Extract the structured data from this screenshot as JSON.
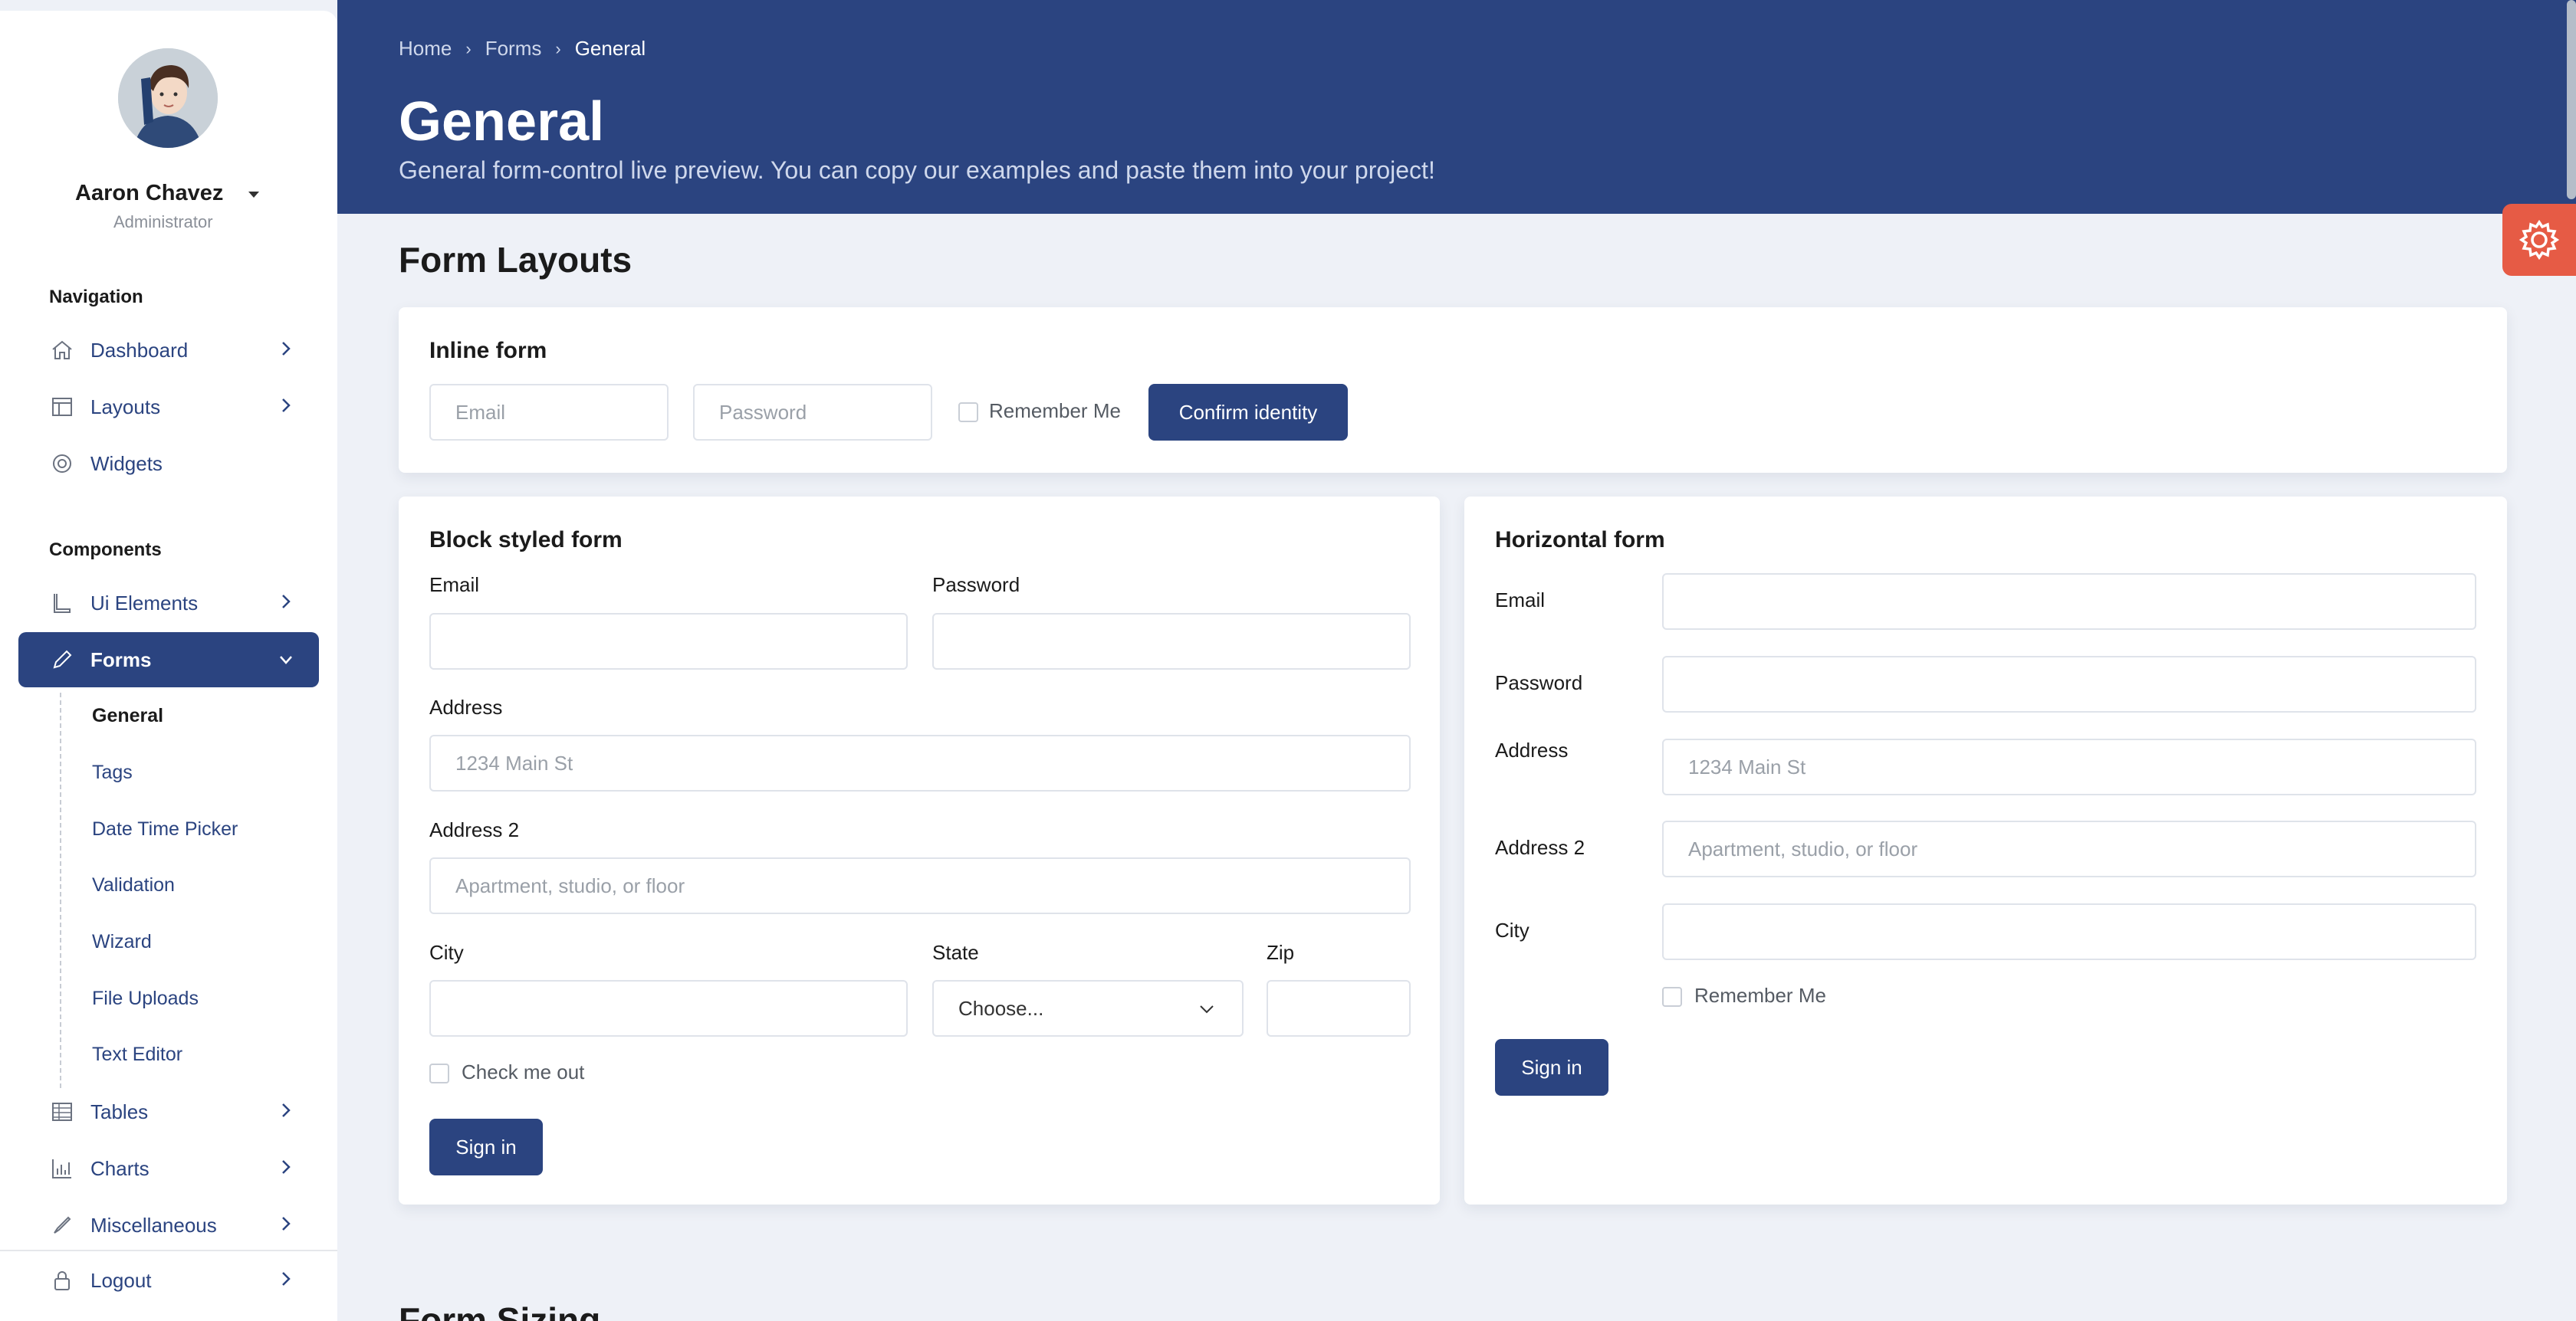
{
  "user": {
    "name": "Aaron Chavez",
    "role": "Administrator"
  },
  "sidebar": {
    "nav_title": "Navigation",
    "nav_items": [
      {
        "label": "Dashboard",
        "icon": "home-icon"
      },
      {
        "label": "Layouts",
        "icon": "layout-icon"
      },
      {
        "label": "Widgets",
        "icon": "widget-icon"
      }
    ],
    "components_title": "Components",
    "component_items": [
      {
        "label": "Ui Elements",
        "icon": "boot-icon"
      },
      {
        "label": "Forms",
        "icon": "pencil-icon"
      },
      {
        "label": "Tables",
        "icon": "table-icon"
      },
      {
        "label": "Charts",
        "icon": "chart-icon"
      },
      {
        "label": "Miscellaneous",
        "icon": "brush-icon"
      }
    ],
    "forms_sub": [
      "General",
      "Tags",
      "Date Time Picker",
      "Validation",
      "Wizard",
      "File Uploads",
      "Text Editor"
    ],
    "logout": "Logout"
  },
  "header": {
    "breadcrumb": [
      "Home",
      "Forms",
      "General"
    ],
    "title": "General",
    "subtitle": "General form-control live preview. You can copy our examples and paste them into your project!"
  },
  "section": {
    "form_layouts": "Form Layouts",
    "form_sizing": "Form Sizing"
  },
  "inline_form": {
    "title": "Inline form",
    "email_placeholder": "Email",
    "password_placeholder": "Password",
    "remember": "Remember Me",
    "button": "Confirm identity"
  },
  "block_form": {
    "title": "Block styled form",
    "email": "Email",
    "password": "Password",
    "address": "Address",
    "address_placeholder": "1234 Main St",
    "address2": "Address 2",
    "address2_placeholder": "Apartment, studio, or floor",
    "city": "City",
    "state": "State",
    "state_value": "Choose...",
    "zip": "Zip",
    "check": "Check me out",
    "button": "Sign in"
  },
  "horizontal_form": {
    "title": "Horizontal form",
    "email": "Email",
    "password": "Password",
    "address": "Address",
    "address_placeholder": "1234 Main St",
    "address2": "Address 2",
    "address2_placeholder": "Apartment, studio, or floor",
    "city": "City",
    "remember": "Remember Me",
    "button": "Sign in"
  },
  "colors": {
    "primary": "#2b4480",
    "accent": "#e65b45",
    "background": "#eef1f7"
  }
}
